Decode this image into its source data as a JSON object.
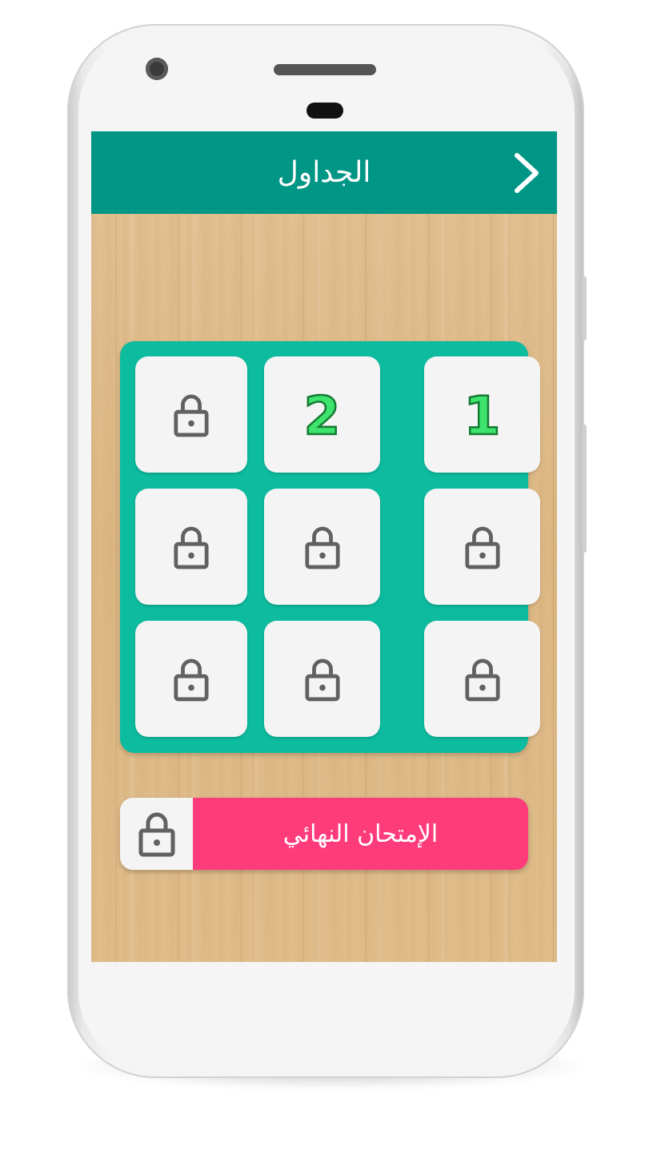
{
  "header": {
    "title": "الجداول",
    "back_icon": "chevron-right-icon"
  },
  "colors": {
    "app_bar": "#009685",
    "grid_panel": "#0dbb9f",
    "tile": "#f4f4f4",
    "unlocked_number": "#3de36c",
    "exam_button": "#ff3c7b",
    "wood": "#dcb885"
  },
  "levels": {
    "tiles": [
      {
        "label": "1",
        "locked": false
      },
      {
        "label": "2",
        "locked": false
      },
      {
        "label": "",
        "locked": true
      },
      {
        "label": "",
        "locked": true
      },
      {
        "label": "",
        "locked": true
      },
      {
        "label": "",
        "locked": true
      },
      {
        "label": "",
        "locked": true
      },
      {
        "label": "",
        "locked": true
      },
      {
        "label": "",
        "locked": true
      }
    ]
  },
  "final_exam": {
    "label": "الإمتحان النهائي",
    "locked": true,
    "icon": "lock-icon"
  }
}
